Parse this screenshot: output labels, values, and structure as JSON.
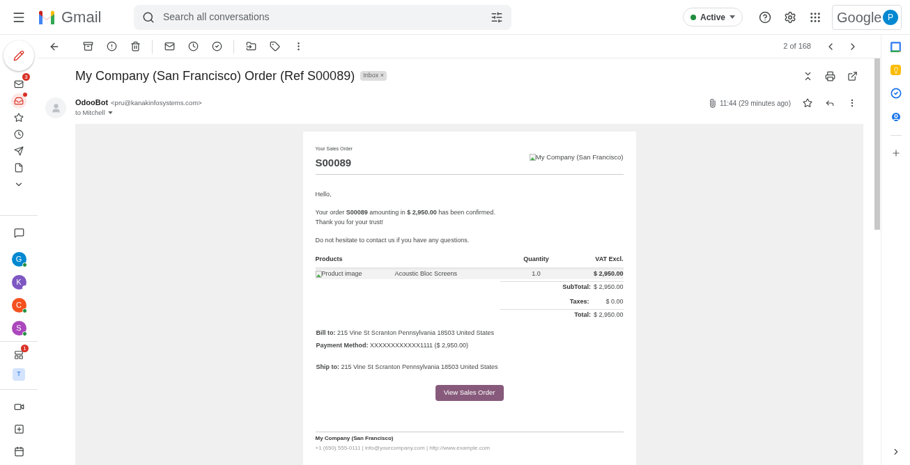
{
  "topbar": {
    "logo_text": "Gmail",
    "search": {
      "placeholder": "Search all conversations"
    },
    "status": {
      "label": "Active",
      "color": "#1e8e3e"
    },
    "account": {
      "brand": "Google",
      "avatar": "P"
    }
  },
  "left_rail": {
    "nav": [
      {
        "kind": "mail",
        "badge": "3",
        "selected": false,
        "unread": false
      },
      {
        "kind": "inbox",
        "selected": true,
        "unread": true
      },
      {
        "kind": "star",
        "selected": false,
        "unread": false
      },
      {
        "kind": "clock",
        "selected": false,
        "unread": false
      },
      {
        "kind": "send",
        "selected": false,
        "unread": false
      },
      {
        "kind": "file",
        "selected": false,
        "unread": false
      },
      {
        "kind": "more",
        "selected": false,
        "unread": false
      }
    ],
    "chat": [
      {
        "initial": "G",
        "color": "#0288d1",
        "online": true
      },
      {
        "initial": "K",
        "color": "#7e57c2",
        "online": false
      },
      {
        "initial": "C",
        "color": "#f4511e",
        "online": true
      },
      {
        "initial": "S",
        "color": "#ab47bc",
        "online": true
      }
    ],
    "spaces": {
      "badge": "1",
      "space_initial": "T"
    }
  },
  "toolbar": {
    "counter": "2 of 168"
  },
  "message": {
    "subject": "My Company (San Francisco) Order (Ref S00089)",
    "label": "Inbox",
    "label_close": "×",
    "sender_name": "OdooBot",
    "sender_email": "<pru@kanakinfosystems.com>",
    "recipient": "to Mitchell",
    "time": "11:44 (29 minutes ago)"
  },
  "email": {
    "kicker": "Your Sales Order",
    "order_ref": "S00089",
    "logo_alt": "My Company (San Francisco)",
    "greeting": "Hello,",
    "paragraphs": [
      "Your order **S00089** amounting in **$ 2,950.00** has been confirmed.",
      "Thank you for your trust!"
    ],
    "closing": "Do not hesitate to contact us if you have any questions.",
    "table": {
      "columns": [
        "Products",
        "Quantity",
        "VAT Excl."
      ],
      "rows": [
        {
          "image_alt": "Product image",
          "product": "Acoustic Bloc Screens",
          "quantity": "1.0",
          "amount": "$ 2,950.00"
        }
      ]
    },
    "totals": [
      {
        "label": "SubTotal:",
        "value": "$ 2,950.00"
      },
      {
        "label": "Taxes:",
        "value": "$ 0.00"
      },
      {
        "label": "Total:",
        "value": "$ 2,950.00"
      }
    ],
    "addresses": [
      "**Bill to:** 215 Vine St Scranton Pennsylvania 18503 United States",
      "**Payment Method:** XXXXXXXXXXXX1111 ($ 2,950.00)",
      "**Ship to:** 215 Vine St Scranton Pennsylvania 18503 United States"
    ],
    "button": "View Sales Order",
    "footer": {
      "company": "My Company (San Francisco)",
      "contacts": "+1 (650) 555-0111 | info@yourcompany.com | http://www.example.com"
    }
  }
}
